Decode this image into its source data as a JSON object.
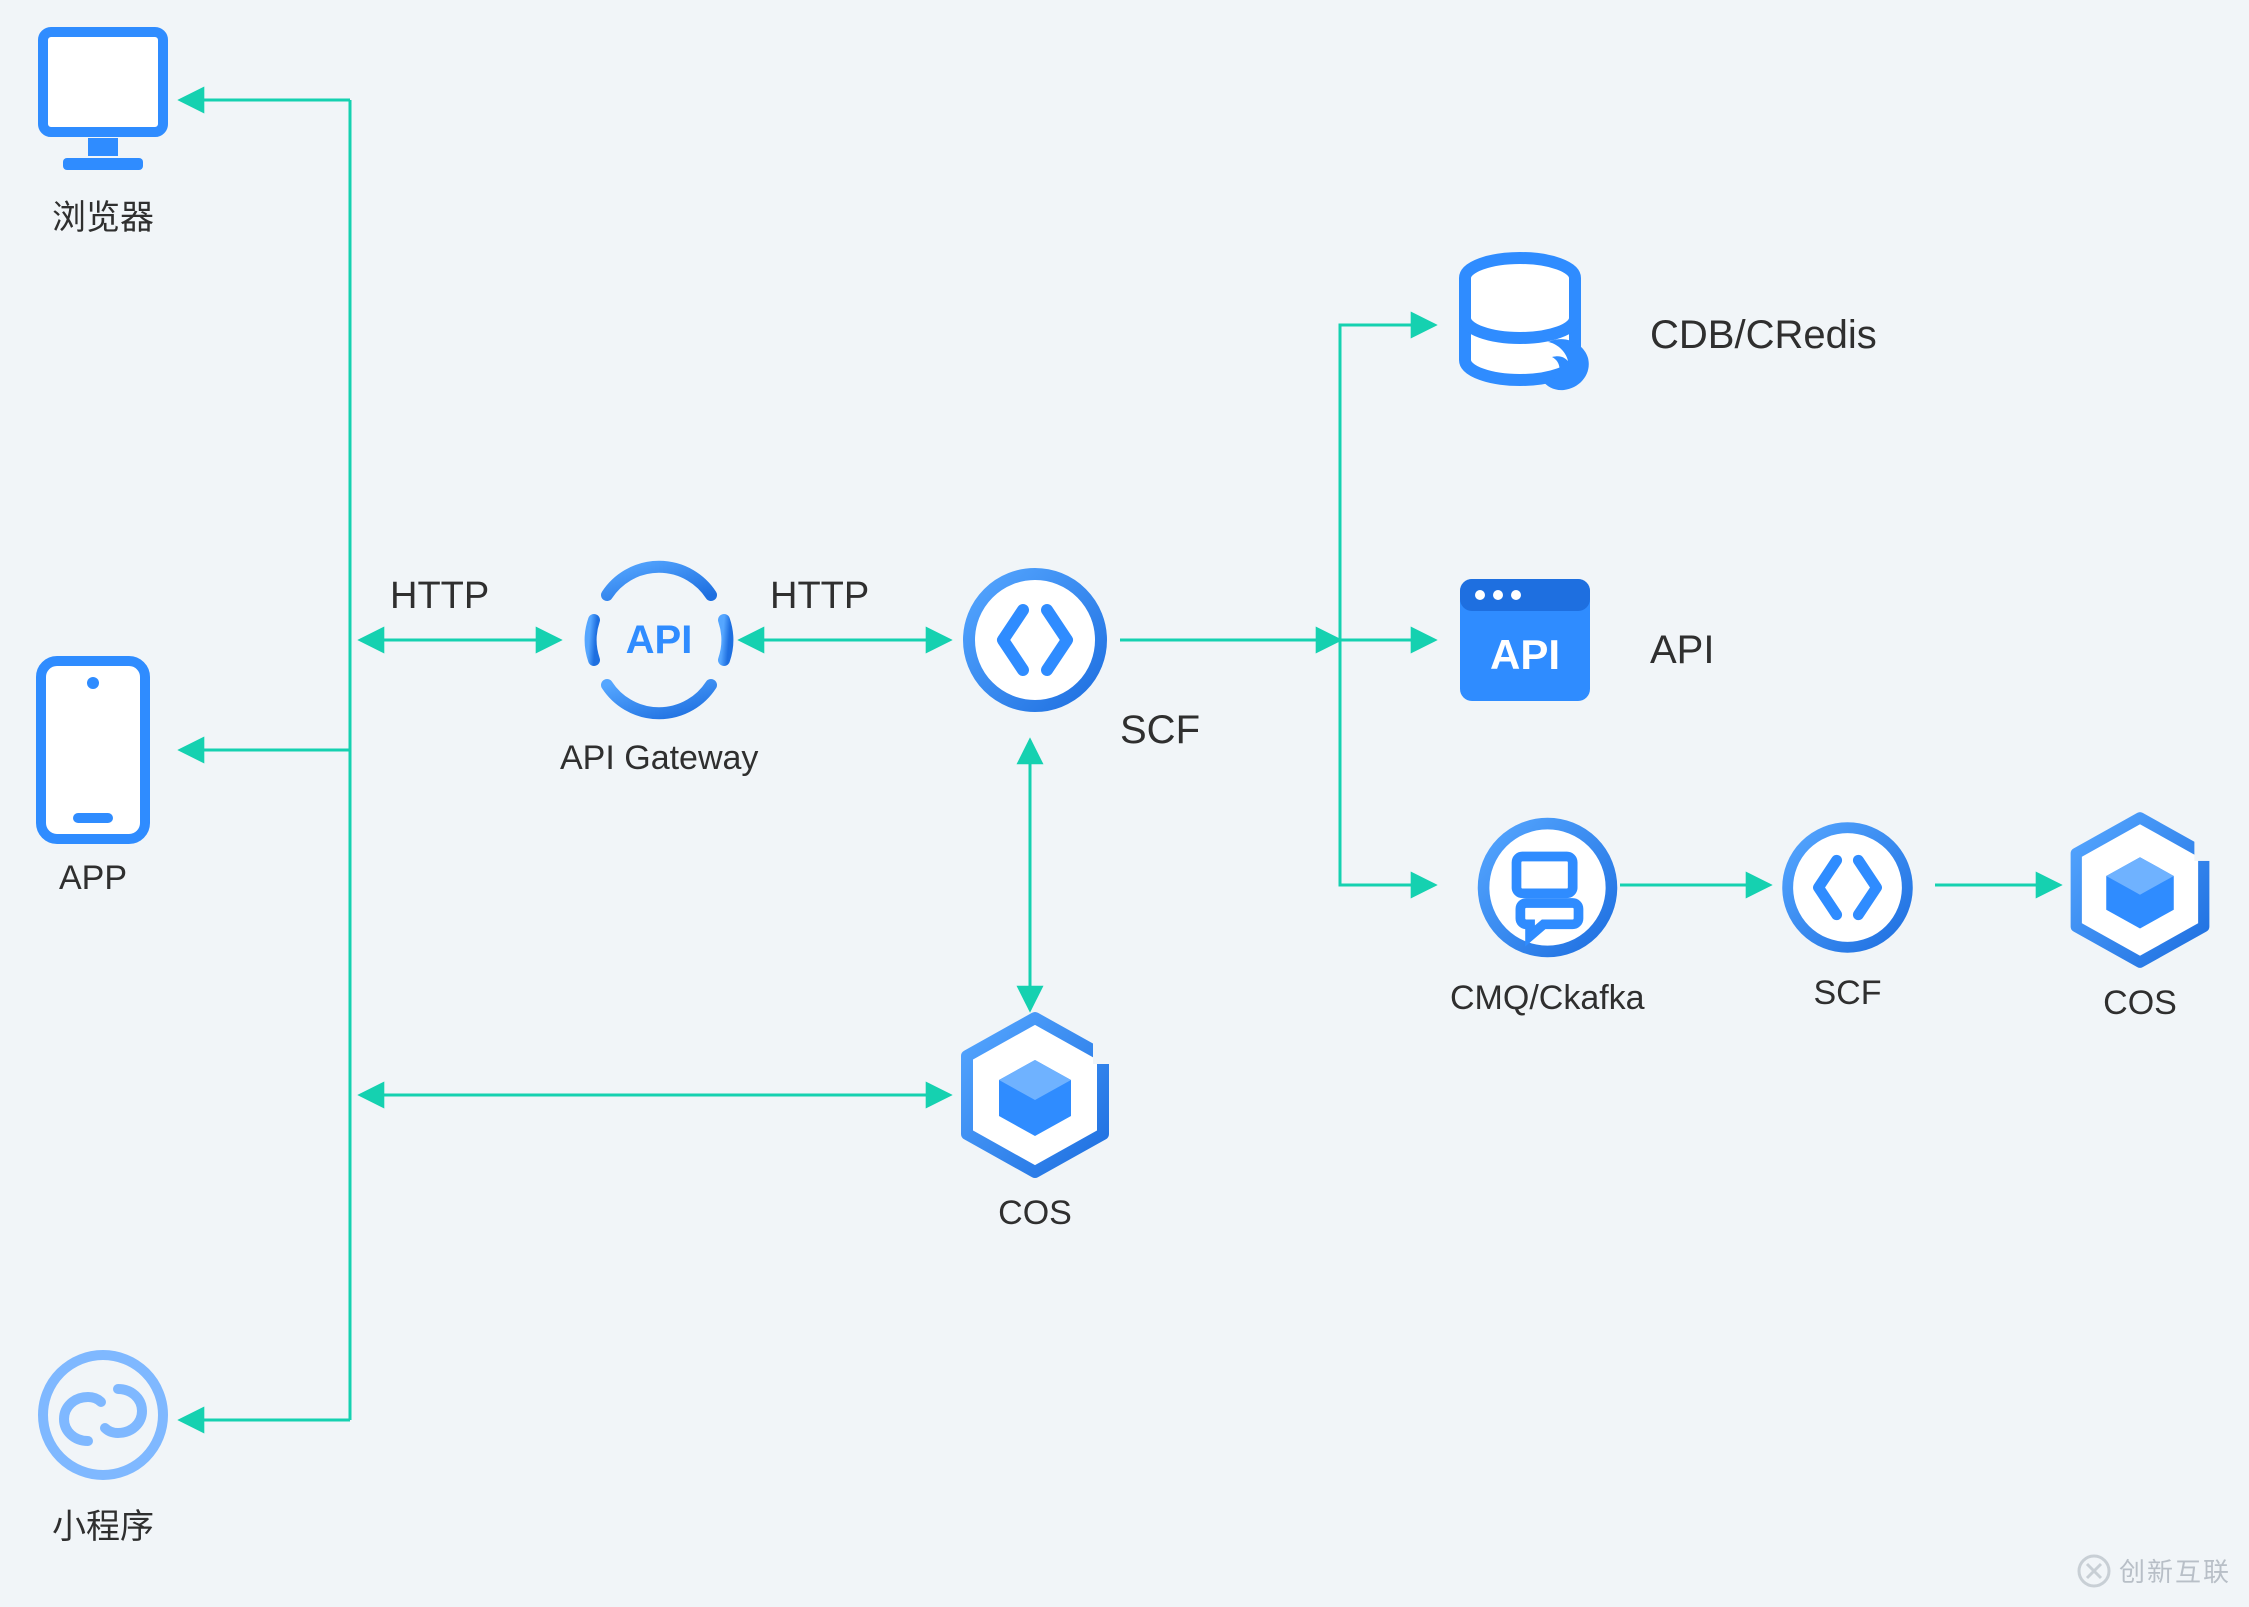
{
  "diagram_type": "cloud-architecture",
  "colors": {
    "icon_blue": "#2f8cff",
    "icon_blue_dark": "#1e6fe0",
    "arrow": "#15d1b0",
    "bg": "#f1f5f8",
    "text": "#2f2f2f",
    "watermark": "#b8bfc7"
  },
  "clients": {
    "browser": {
      "label": "浏览器"
    },
    "app": {
      "label": "APP"
    },
    "miniprog": {
      "label": "小程序"
    }
  },
  "core": {
    "api_gateway": {
      "label": "API Gateway"
    },
    "scf": {
      "label": "SCF"
    },
    "cos": {
      "label": "COS"
    }
  },
  "edges": {
    "client_to_gateway": "HTTP",
    "gateway_to_scf": "HTTP"
  },
  "backends": {
    "cdb_credis": {
      "label": "CDB/CRedis"
    },
    "api": {
      "label": "API"
    },
    "cmq_ckafka": {
      "label": "CMQ/Ckafka"
    },
    "scf2": {
      "label": "SCF"
    },
    "cos2": {
      "label": "COS"
    }
  },
  "watermark": "创新互联"
}
